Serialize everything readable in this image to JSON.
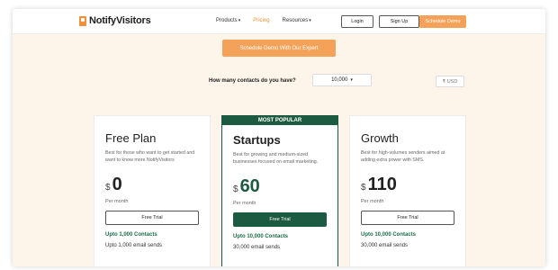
{
  "header": {
    "logo_text": "NotifyVisitors",
    "nav": [
      {
        "label": "Products"
      },
      {
        "label": "Pricing"
      },
      {
        "label": "Resources"
      }
    ],
    "login_label": "Login",
    "signup_label": "Sign Up",
    "demo_label": "Schedule Demo",
    "accent_color": "#f4a259"
  },
  "hero": {
    "schedule_label": "Schedule Demo With Our Expert",
    "contacts_question": "How many contacts do you have?",
    "contacts_value": "10,000",
    "currency_label": "₹ USD"
  },
  "plans": [
    {
      "name": "Free Plan",
      "description": "Best for those who want to get started and want to know more NotifyVisitors",
      "currency": "$",
      "price": "0",
      "period": "Per month",
      "cta": "Free Trial",
      "contacts": "Upto 1,000 Contacts",
      "feature1": "Upto 1,000 email sends"
    },
    {
      "badge": "MOST POPULAR",
      "name": "Startups",
      "description": "Best for growing and medium-sized businesses focused on email marketing.",
      "currency": "$",
      "price": "60",
      "period": "Per month",
      "cta": "Free Trial",
      "contacts": "Upto 10,000 Contacts",
      "feature1": "30,000 email sends"
    },
    {
      "name": "Growth",
      "description": "Best for high-volumes senders aimed at adding extra power with SMS.",
      "currency": "$",
      "price": "110",
      "period": "Per month",
      "cta": "Free Trial",
      "contacts": "Upto 10,000 Contacts",
      "feature1": "30,000 email sends"
    }
  ],
  "theme": {
    "primary_green": "#1d5a42",
    "background": "#fdf4ea"
  }
}
